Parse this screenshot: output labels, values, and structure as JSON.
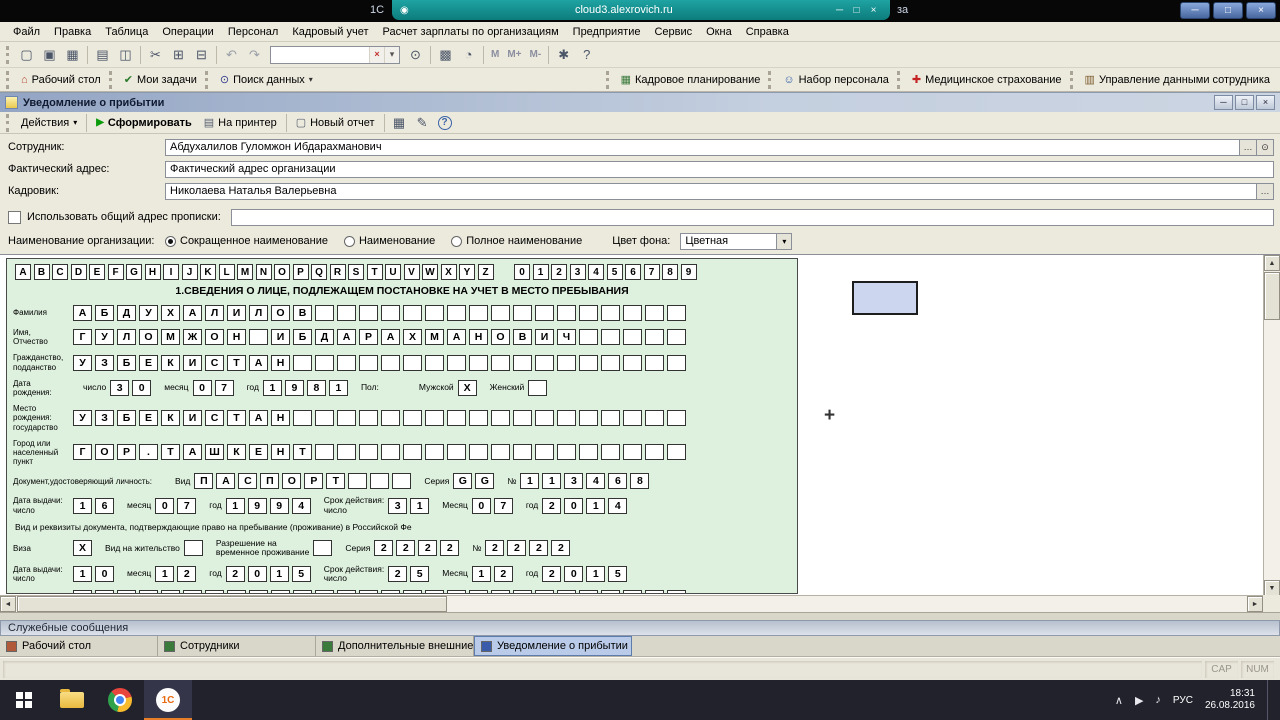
{
  "title_bar": {
    "left_fragment": "1С",
    "right_fragment": "за",
    "rdp_address": "cloud3.alexrovich.ru"
  },
  "menu_bar": {
    "items": [
      "Файл",
      "Правка",
      "Таблица",
      "Операции",
      "Персонал",
      "Кадровый учет",
      "Расчет зарплаты по организациям",
      "Предприятие",
      "Сервис",
      "Окна",
      "Справка"
    ]
  },
  "main_toolbar": {
    "items": [
      {
        "type": "icon",
        "name": "new-document-icon",
        "glyph": "▢"
      },
      {
        "type": "icon",
        "name": "open-icon",
        "glyph": "▣"
      },
      {
        "type": "icon",
        "name": "save-icon",
        "glyph": "▦"
      },
      {
        "type": "sep"
      },
      {
        "type": "icon",
        "name": "print-icon",
        "glyph": "▤"
      },
      {
        "type": "icon",
        "name": "print-preview-icon",
        "glyph": "◫"
      },
      {
        "type": "sep"
      },
      {
        "type": "icon",
        "name": "cut-icon",
        "glyph": "✂"
      },
      {
        "type": "icon",
        "name": "copy-icon",
        "glyph": "⊞"
      },
      {
        "type": "icon",
        "name": "paste-icon",
        "glyph": "⊟"
      },
      {
        "type": "sep"
      },
      {
        "type": "icon",
        "name": "undo-icon",
        "glyph": "↶",
        "dim": true
      },
      {
        "type": "icon",
        "name": "redo-icon",
        "glyph": "↷",
        "dim": true
      },
      {
        "type": "search"
      },
      {
        "type": "icon",
        "name": "find-icon",
        "glyph": "⊙"
      },
      {
        "type": "sep"
      },
      {
        "type": "icon",
        "name": "calendar-icon",
        "glyph": "▩"
      },
      {
        "type": "icon",
        "name": "calculator-icon",
        "glyph": "◔"
      },
      {
        "type": "sep"
      },
      {
        "type": "text",
        "name": "memory-recall-button",
        "label": "М"
      },
      {
        "type": "text",
        "name": "memory-add-button",
        "label": "М+"
      },
      {
        "type": "text",
        "name": "memory-subtract-button",
        "label": "М-"
      },
      {
        "type": "sep"
      },
      {
        "type": "icon",
        "name": "service-menu-icon",
        "glyph": "✱"
      },
      {
        "type": "icon",
        "name": "help-icon",
        "glyph": "?"
      }
    ]
  },
  "panel_bar": {
    "left": [
      {
        "name": "desktop-panel-button",
        "label": "Рабочий стол",
        "glyph": "⌂",
        "color": "#b04a30"
      },
      {
        "name": "my-tasks-button",
        "label": "Мои задачи",
        "glyph": "✔",
        "color": "#2a7a2a"
      },
      {
        "name": "data-search-button",
        "label": "Поиск данных",
        "glyph": "⊙",
        "color": "#33408c",
        "dropdown": true
      }
    ],
    "right": [
      {
        "name": "hr-planning-button",
        "label": "Кадровое планирование",
        "glyph": "▦",
        "color": "#3a7a3a"
      },
      {
        "name": "recruitment-button",
        "label": "Набор персонала",
        "glyph": "☺",
        "color": "#2a5aaa"
      },
      {
        "name": "medical-insurance-button",
        "label": "Медицинское страхование",
        "glyph": "✚",
        "color": "#c42222"
      },
      {
        "name": "employee-data-button",
        "label": "Управление данными сотрудника",
        "glyph": "▥",
        "color": "#7a5a2a"
      }
    ]
  },
  "document_window": {
    "title": "Уведомление о прибытии"
  },
  "action_bar": {
    "actions_label": "Действия",
    "generate_label": "Сформировать",
    "printer_label": "На принтер",
    "new_report_label": "Новый отчет"
  },
  "form_panel": {
    "employee_label": "Сотрудник:",
    "employee_value": "Абдухалилов Гуломжон Ибдарахманович",
    "address_label": "Фактический адрес:",
    "address_value": "Фактический адрес организации",
    "hr_label": "Кадровик:",
    "hr_value": "Николаева Наталья Валерьевна",
    "common_address_label": "Использовать общий адрес прописки:",
    "org_name_label": "Наименование организации:",
    "org_options": [
      "Сокращенное наименование",
      "Наименование",
      "Полное наименование"
    ],
    "org_selected": 0,
    "bg_color_label": "Цвет фона:",
    "bg_color_value": "Цветная"
  },
  "doc": {
    "header_letters": "ABCDEFGHIJKLMNOPQRSTUVWXYZ",
    "header_digits": "0123456789",
    "section_title": "1.СВЕДЕНИЯ О ЛИЦЕ, ПОДЛЕЖАЩЕМ ПОСТАНОВКЕ НА УЧЕТ В МЕСТО ПРЕБЫВАНИЯ",
    "rows": [
      {
        "label": "Фамилия",
        "cells": [
          {
            "boxes": "АБДУХАЛИЛОВ",
            "pad": 17
          }
        ]
      },
      {
        "label": "Имя,\nОтчество",
        "cells": [
          {
            "boxes": "ГУЛОМЖОН ИБДАРАХМАНОВИЧ",
            "pad": 5
          }
        ]
      },
      {
        "label": "Гражданство,\nподданство",
        "cells": [
          {
            "boxes": "УЗБЕКИСТАН",
            "pad": 18
          }
        ]
      },
      {
        "label": "Дата\nрождения:",
        "cells": [
          {
            "pre": "число",
            "boxes": "30"
          },
          {
            "pre": "месяц",
            "boxes": "07"
          },
          {
            "pre": "год",
            "boxes": "1981"
          },
          {
            "pre": "Пол:",
            "gap": 26
          },
          {
            "pre": "Мужской",
            "boxes": "X"
          },
          {
            "pre": "Женский",
            "boxes": " "
          }
        ]
      },
      {
        "label": "Место рождения:\nгосударство",
        "cells": [
          {
            "boxes": "УЗБЕКИСТАН",
            "pad": 18
          }
        ]
      },
      {
        "label": "Город или\nнаселенный пункт",
        "cells": [
          {
            "boxes": "ГОР.ТАШКЕНТ",
            "pad": 17
          }
        ]
      },
      {
        "label": "Документ,удостоверяющий личность:",
        "label_w": 152,
        "cells": [
          {
            "pre": "Вид",
            "boxes": "ПАСПОРТ",
            "pad": 3
          },
          {
            "pre": "Серия",
            "boxes": "GG"
          },
          {
            "pre": "№",
            "boxes": "113468"
          }
        ]
      },
      {
        "label": "Дата выдачи:\nчисло",
        "cells": [
          {
            "boxes": "16"
          },
          {
            "pre": "месяц",
            "boxes": "07"
          },
          {
            "pre": "год",
            "boxes": "1994"
          },
          {
            "pre": "Срок действия:\nчисло",
            "boxes": "31"
          },
          {
            "pre": "Месяц",
            "boxes": "07"
          },
          {
            "pre": "год",
            "boxes": "2014"
          }
        ]
      },
      {
        "text": "Вид и реквизиты документа, подтверждающие право на пребывание (проживание) в Российской Фе"
      },
      {
        "label": "Виза",
        "cells": [
          {
            "boxes": "X"
          },
          {
            "pre": "Вид на жительство",
            "boxes": " "
          },
          {
            "pre": "Разрешение на\nвременное проживание",
            "boxes": " "
          },
          {
            "pre": "Серия",
            "boxes": "2222"
          },
          {
            "pre": "№",
            "boxes": "2222"
          }
        ]
      },
      {
        "label": "Дата выдачи:\nчисло",
        "cells": [
          {
            "boxes": "10"
          },
          {
            "pre": "месяц",
            "boxes": "12"
          },
          {
            "pre": "год",
            "boxes": "2015"
          },
          {
            "pre": "Срок действия:\nчисло",
            "boxes": "25"
          },
          {
            "pre": "Месяц",
            "boxes": "12"
          },
          {
            "pre": "год",
            "boxes": "2015"
          }
        ]
      },
      {
        "label": "",
        "cells": [
          {
            "boxes": "",
            "pad": 28
          }
        ]
      }
    ]
  },
  "messages_panel": {
    "title": "Служебные сообщения"
  },
  "task_tabs": [
    {
      "label": "Рабочий стол",
      "icon_color": "#b05a3a",
      "active": false
    },
    {
      "label": "Сотрудники",
      "icon_color": "#3a7a3a",
      "active": false
    },
    {
      "label": "Дополнительные внешние ...",
      "icon_color": "#3a7a3a",
      "active": false
    },
    {
      "label": "Уведомление о прибытии",
      "icon_color": "#3a5aaa",
      "active": true
    }
  ],
  "status_bar": {
    "cap": "CAP",
    "num": "NUM"
  },
  "taskbar": {
    "language": "РУС",
    "time": "18:31",
    "date": "26.08.2016"
  },
  "colors": {
    "accent_teal": "#0d7c7c",
    "form_green": "#def0de",
    "active_tab": "#b9cbe8",
    "taskbar": "#22222d"
  }
}
